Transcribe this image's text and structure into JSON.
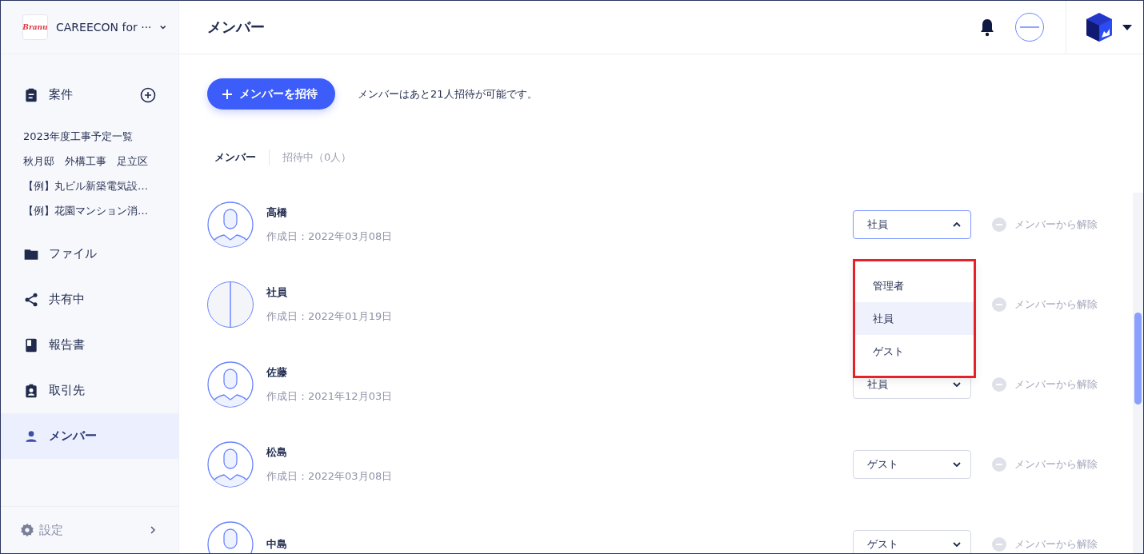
{
  "workspace": {
    "logo_text": "Branu",
    "name": "CAREECON for ···"
  },
  "sidebar": {
    "items": [
      {
        "kind": "group",
        "label": "案件",
        "selected": false,
        "children": [
          {
            "label": "2023年度工事予定一覧"
          },
          {
            "label": "秋月邸　外構工事　足立区"
          },
          {
            "label": "【例】丸ビル新築電気設…"
          },
          {
            "label": "【例】花園マンション消…"
          }
        ]
      },
      {
        "kind": "link",
        "label": "ファイル",
        "selected": false
      },
      {
        "kind": "link",
        "label": "共有中",
        "selected": false
      },
      {
        "kind": "link",
        "label": "報告書",
        "selected": false
      },
      {
        "kind": "link",
        "label": "取引先",
        "selected": false
      },
      {
        "kind": "link",
        "label": "メンバー",
        "selected": true
      }
    ],
    "settings": "設定"
  },
  "page_title": "メンバー",
  "invite_button": "メンバーを招待",
  "invite_note": "メンバーはあと21人招待が可能です。",
  "tabs": [
    {
      "label": "メンバー",
      "selected": true
    },
    {
      "label": "招待中（0人）",
      "selected": false
    }
  ],
  "members": [
    {
      "name": "高橋",
      "created": "作成日：2022年03月08日",
      "kind": "default",
      "role": "社員",
      "remove": "メンバーから解除",
      "dropdown": {
        "highlighted": true,
        "options": [
          {
            "label": "管理者",
            "selected": false
          },
          {
            "label": "社員",
            "selected": true
          },
          {
            "label": "ゲスト",
            "selected": false
          }
        ]
      }
    },
    {
      "name": "社員",
      "created": "作成日：2022年01月19日",
      "kind": "image",
      "remove": "メンバーから解除"
    },
    {
      "name": "佐藤",
      "created": "作成日：2021年12月03日",
      "kind": "default",
      "role": "社員",
      "remove": "メンバーから解除"
    },
    {
      "name": "松島",
      "created": "作成日：2022年03月08日",
      "kind": "default",
      "role": "ゲスト",
      "remove": "メンバーから解除"
    },
    {
      "name": "中島",
      "kind": "default",
      "role": "ゲスト",
      "remove": "メンバーから解除"
    }
  ]
}
